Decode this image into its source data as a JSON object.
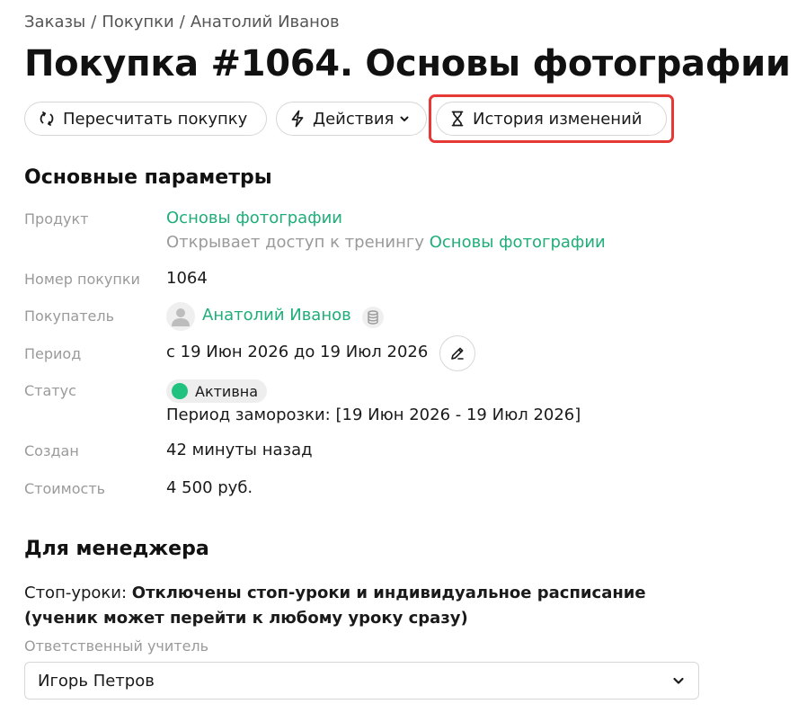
{
  "breadcrumb": {
    "items": [
      "Заказы",
      "Покупки",
      "Анатолий Иванов"
    ],
    "separator": "/"
  },
  "page_title": "Покупка #1064. Основы фотографии",
  "toolbar": {
    "recalc_label": "Пересчитать покупку",
    "recalc_icon": "refresh-icon",
    "actions_label": "Действия",
    "actions_icon": "lightning-icon",
    "history_label": "История изменений",
    "history_icon": "hourglass-icon"
  },
  "params": {
    "heading": "Основные параметры",
    "product": {
      "label": "Продукт",
      "name": "Основы фотографии",
      "access_prefix": "Открывает доступ к тренингу",
      "access_link": "Основы фотографии"
    },
    "number": {
      "label": "Номер покупки",
      "value": "1064"
    },
    "buyer": {
      "label": "Покупатель",
      "name": "Анатолий Иванов"
    },
    "period": {
      "label": "Период",
      "value": "с 19 Июн 2026 до 19 Июл 2026"
    },
    "status": {
      "label": "Статус",
      "badge": "Активна",
      "freeze": "Период заморозки: [19 Июн 2026 - 19 Июл 2026]"
    },
    "created": {
      "label": "Создан",
      "value": "42 минуты назад"
    },
    "cost": {
      "label": "Стоимость",
      "value": "4 500 руб."
    }
  },
  "manager": {
    "heading": "Для менеджера",
    "stop_label": "Стоп-уроки:",
    "stop_value": "Отключены стоп-уроки и индивидуальное расписание (ученик может перейти к любому уроку сразу)",
    "teacher_label": "Ответственный учитель",
    "teacher_value": "Игорь Петров"
  },
  "colors": {
    "link": "#1fae7a",
    "status_dot": "#1fc27e",
    "highlight": "#e53935",
    "muted": "#9a9a9a"
  }
}
